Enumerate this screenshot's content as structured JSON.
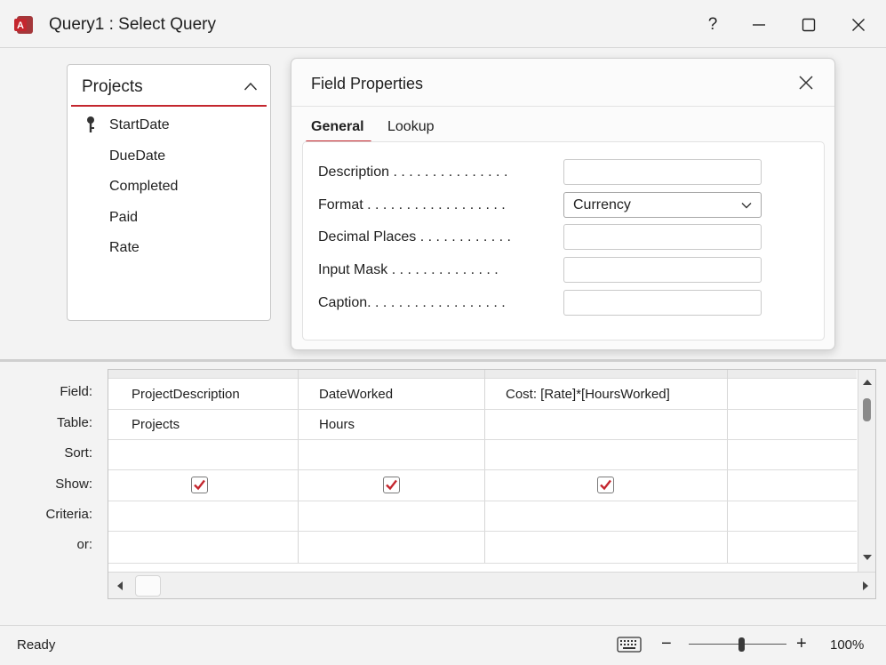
{
  "window": {
    "title": "Query1 : Select Query",
    "app_icon": "access-icon",
    "brand_color": "#c4262e",
    "help_label": "?"
  },
  "table_box": {
    "name": "Projects",
    "fields": [
      {
        "label": "StartDate",
        "primary_key": true
      },
      {
        "label": "DueDate",
        "primary_key": false
      },
      {
        "label": "Completed",
        "primary_key": false
      },
      {
        "label": "Paid",
        "primary_key": false
      },
      {
        "label": "Rate",
        "primary_key": false
      }
    ]
  },
  "field_properties": {
    "title": "Field Properties",
    "tabs": [
      {
        "label": "General",
        "active": true
      },
      {
        "label": "Lookup",
        "active": false
      }
    ],
    "properties": [
      {
        "label": "Description . . . . . . . . . . . . . . .",
        "value": ""
      },
      {
        "label": "Format . . . . . . . . . . . . . . . . . .",
        "value": "Currency",
        "type": "select"
      },
      {
        "label": "Decimal Places . . . . . . . . . . . .",
        "value": ""
      },
      {
        "label": "Input Mask . . . . . . . . . . . . . .",
        "value": ""
      },
      {
        "label": "Caption. . . . . . . . . . . . . . . . . .",
        "value": ""
      }
    ]
  },
  "query_grid": {
    "row_labels": [
      "Field:",
      "Table:",
      "Sort:",
      "Show:",
      "Criteria:",
      "or:"
    ],
    "columns": [
      {
        "field": "ProjectDescription",
        "table": "Projects",
        "sort": "",
        "show": true,
        "criteria": "",
        "or": ""
      },
      {
        "field": "DateWorked",
        "table": "Hours",
        "sort": "",
        "show": true,
        "criteria": "",
        "or": ""
      },
      {
        "field": "Cost: [Rate]*[HoursWorked]",
        "table": "",
        "sort": "",
        "show": true,
        "criteria": "",
        "or": ""
      },
      {
        "field": "",
        "table": "",
        "sort": "",
        "show": false,
        "criteria": "",
        "or": ""
      }
    ]
  },
  "status_bar": {
    "status": "Ready",
    "zoom_level": "100%",
    "zoom_fraction": 0.5
  }
}
